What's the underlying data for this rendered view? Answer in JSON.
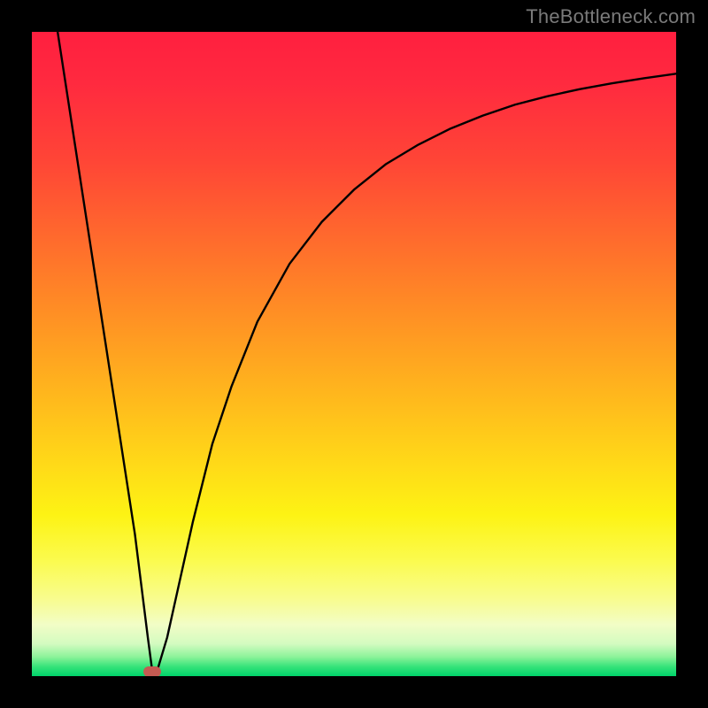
{
  "watermark": "TheBottleneck.com",
  "marker": {
    "x_pct": 18.7,
    "y_pct": 99.3
  },
  "chart_data": {
    "type": "line",
    "title": "",
    "xlabel": "",
    "ylabel": "",
    "xlim": [
      0,
      100
    ],
    "ylim": [
      0,
      100
    ],
    "grid": false,
    "legend": false,
    "series": [
      {
        "name": "bottleneck-curve",
        "x": [
          4,
          6,
          8,
          10,
          12,
          14,
          16,
          17,
          18,
          18.7,
          19.5,
          21,
          23,
          25,
          28,
          31,
          35,
          40,
          45,
          50,
          55,
          60,
          65,
          70,
          75,
          80,
          85,
          90,
          95,
          100
        ],
        "y": [
          100,
          87,
          74,
          61,
          48,
          35,
          22,
          14,
          6,
          0.7,
          1,
          6,
          15,
          24,
          36,
          45,
          55,
          64,
          70.5,
          75.5,
          79.5,
          82.5,
          85,
          87,
          88.7,
          90,
          91.1,
          92,
          92.8,
          93.5
        ]
      }
    ],
    "annotations": [
      {
        "name": "optimal-marker",
        "x": 18.7,
        "y": 0.7
      }
    ],
    "background_gradient_stops": [
      {
        "pct": 0,
        "color": "#ff1f3f"
      },
      {
        "pct": 20,
        "color": "#ff4536"
      },
      {
        "pct": 44,
        "color": "#ff9024"
      },
      {
        "pct": 67,
        "color": "#ffd918"
      },
      {
        "pct": 82,
        "color": "#fbfb4e"
      },
      {
        "pct": 95,
        "color": "#d3fbc0"
      },
      {
        "pct": 100,
        "color": "#00d36a"
      }
    ]
  }
}
